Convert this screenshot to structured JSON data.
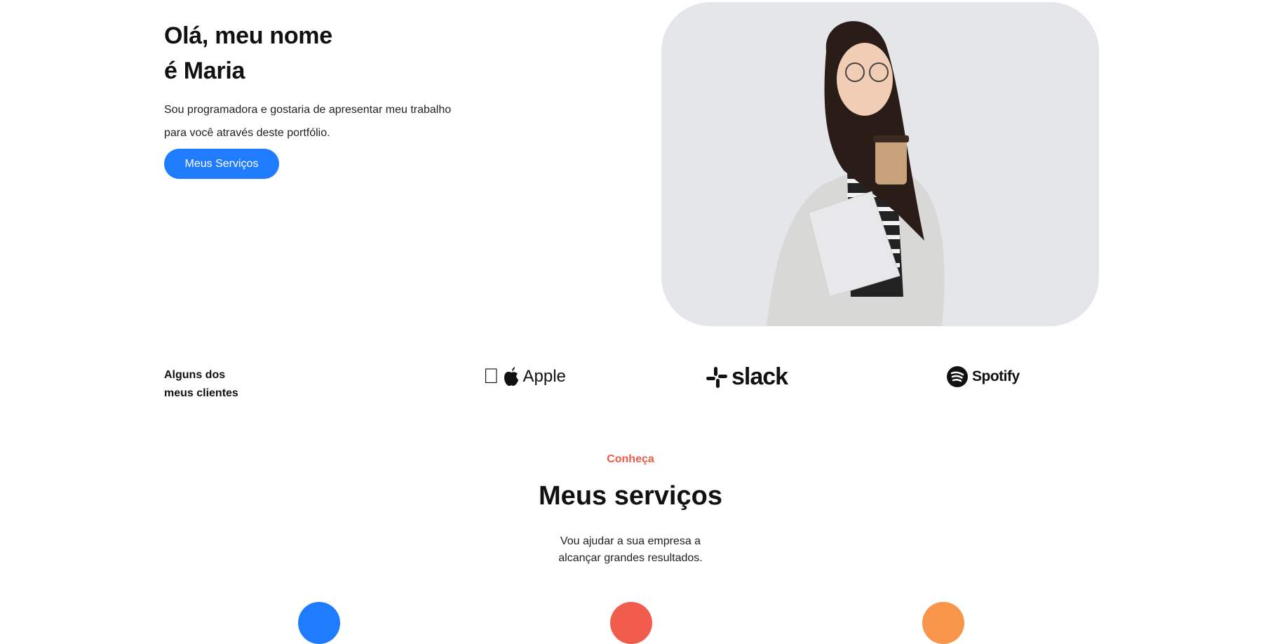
{
  "hero": {
    "title_line1": "Olá, meu nome",
    "title_line2": "é Maria",
    "subtitle": "Sou programadora e gostaria de apresentar meu trabalho para você através deste portfólio.",
    "button_label": "Meus Serviços"
  },
  "clients": {
    "label_line1": "Alguns dos",
    "label_line2": "meus clientes",
    "logos": [
      "Apple",
      "slack",
      "Spotify"
    ]
  },
  "services": {
    "kicker": "Conheça",
    "title": "Meus serviços",
    "desc_line1": "Vou ajudar a sua empresa a",
    "desc_line2": "alcançar grandes resultados.",
    "icon_colors": [
      "#1f7cff",
      "#f25c4c",
      "#f7964b"
    ]
  }
}
